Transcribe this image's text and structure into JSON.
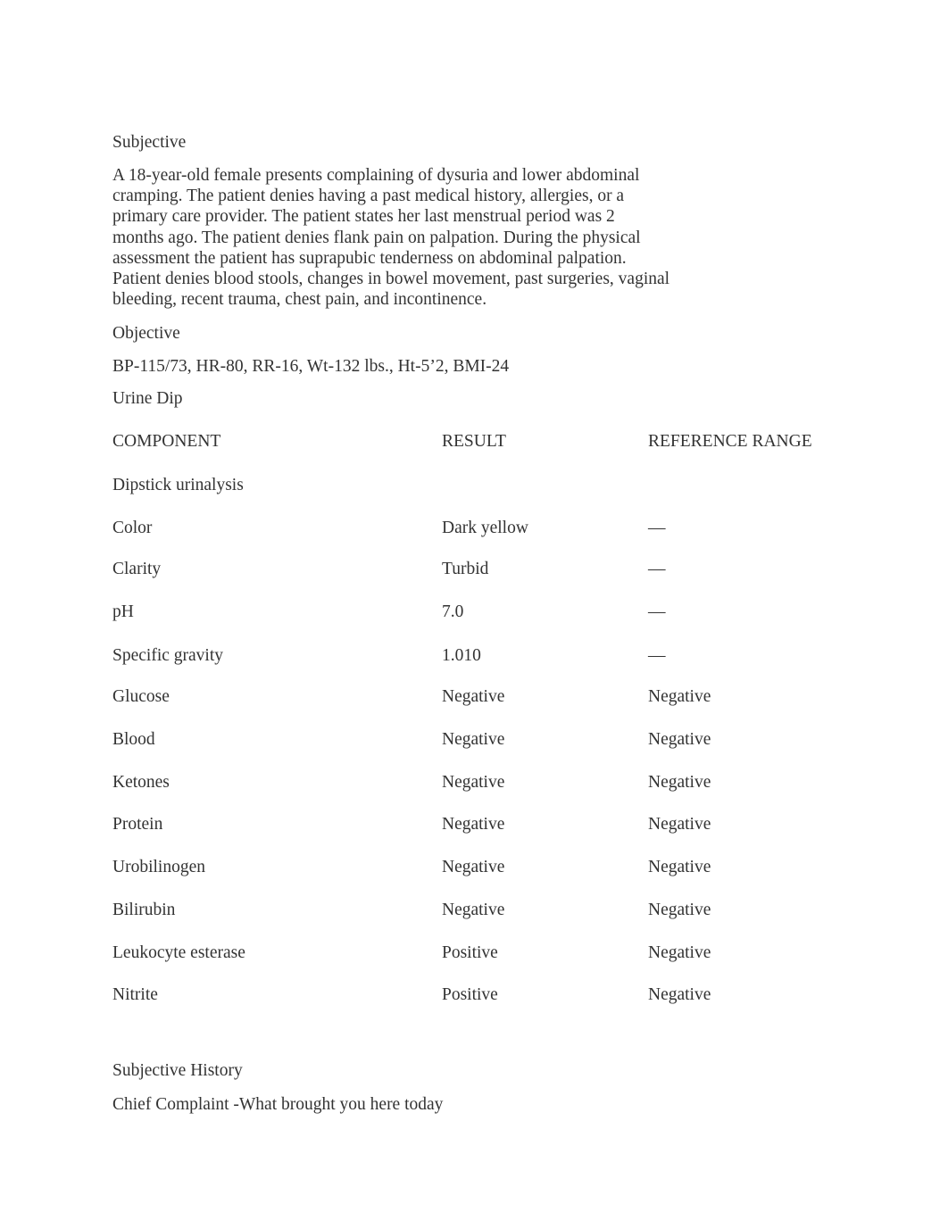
{
  "subjective": {
    "heading": "Subjective",
    "paragraph_lines": [
      "A 18-year-old female presents complaining of dysuria and lower abdominal",
      "cramping. The patient denies having a past medical history, allergies, or a",
      "primary care provider. The patient states her last menstrual period was 2",
      "months ago. The patient denies flank pain on palpation. During the physical",
      "assessment the patient has suprapubic tenderness on abdominal palpation.",
      "Patient denies blood stools, changes in bowel movement, past surgeries, vaginal",
      "bleeding, recent trauma, chest pain, and incontinence."
    ]
  },
  "objective": {
    "heading": "Objective",
    "vitals": "BP-115/73, HR-80, RR-16, Wt-132 lbs., Ht-5’2, BMI-24",
    "urine_dip_label": "Urine Dip"
  },
  "lab_table": {
    "headers": {
      "component": "COMPONENT",
      "result": "RESULT",
      "reference": "REFERENCE RANGE"
    },
    "section_label": "Dipstick urinalysis",
    "rows": [
      {
        "component": "Color",
        "result": "Dark yellow",
        "reference": "—"
      },
      {
        "component": "Clarity",
        "result": "Turbid",
        "reference": "—"
      },
      {
        "component": "pH",
        "result": "7.0",
        "reference": "—"
      },
      {
        "component": "Specific gravity",
        "result": "1.010",
        "reference": "—"
      },
      {
        "component": "Glucose",
        "result": "Negative",
        "reference": "Negative"
      },
      {
        "component": "Blood",
        "result": "Negative",
        "reference": "Negative"
      },
      {
        "component": "Ketones",
        "result": "Negative",
        "reference": "Negative"
      },
      {
        "component": "Protein",
        "result": "Negative",
        "reference": "Negative"
      },
      {
        "component": "Urobilinogen",
        "result": "Negative",
        "reference": "Negative"
      },
      {
        "component": "Bilirubin",
        "result": "Negative",
        "reference": "Negative"
      },
      {
        "component": "Leukocyte esterase",
        "result": "Positive",
        "reference": "Negative"
      },
      {
        "component": "Nitrite",
        "result": "Positive",
        "reference": "Negative"
      }
    ]
  },
  "subjective_history": {
    "heading": "Subjective History",
    "chief_complaint": "Chief Complaint -What brought you here today"
  }
}
